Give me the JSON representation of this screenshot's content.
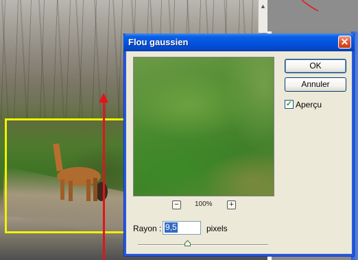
{
  "dialog": {
    "title": "Flou gaussien",
    "ok_label": "OK",
    "cancel_label": "Annuler",
    "preview_checkbox_label": "Aperçu",
    "preview_checked": true,
    "zoom_level": "100%",
    "zoom_out_symbol": "−",
    "zoom_in_symbol": "+",
    "radius_label": "Rayon :",
    "radius_value": "9,5",
    "radius_unit": "pixels",
    "close_symbol": "✕"
  },
  "colors": {
    "titlebar": "#0454e0",
    "dialog_bg": "#ece9d8",
    "selection": "#f2f200",
    "arrow": "#e4131a"
  },
  "icons": [
    "close-icon",
    "zoom-out-icon",
    "zoom-in-icon",
    "checkmark-icon",
    "slider-thumb-icon",
    "scroll-up-icon"
  ]
}
